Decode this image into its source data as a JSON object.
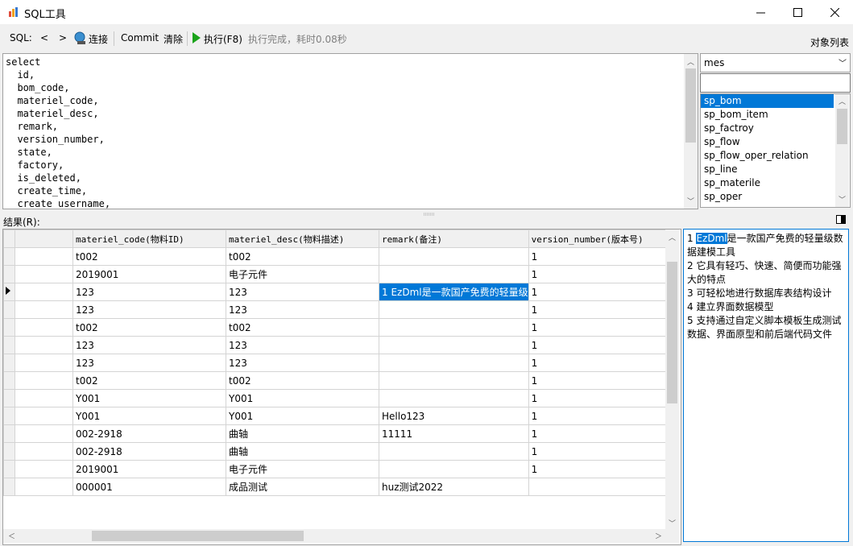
{
  "window": {
    "title": "SQL工具"
  },
  "toolbar": {
    "sql_label": "SQL:",
    "prev": "<",
    "next": ">",
    "connect": "连接",
    "commit": "Commit",
    "clear": "清除",
    "execute": "执行(F8)",
    "status": "执行完成，耗时0.08秒",
    "object_list": "对象列表"
  },
  "editor": {
    "sql_text": "select\n  id,\n  bom_code,\n  materiel_code,\n  materiel_desc,\n  remark,\n  version_number,\n  state,\n  factory,\n  is_deleted,\n  create_time,\n  create_username,"
  },
  "right_panel": {
    "schema": "mes",
    "search_value": "",
    "tables": [
      "sp_bom",
      "sp_bom_item",
      "sp_factroy",
      "sp_flow",
      "sp_flow_oper_relation",
      "sp_line",
      "sp_materile",
      "sp_oper"
    ]
  },
  "results": {
    "label": "结果(R):",
    "columns": [
      "",
      "materiel_code(物料ID)",
      "materiel_desc(物料描述)",
      "remark(备注)",
      "version_number(版本号)"
    ],
    "rows": [
      [
        "",
        "t002",
        "t002",
        "",
        "1"
      ],
      [
        "",
        "2019001",
        "电子元件",
        "",
        "1"
      ],
      [
        "",
        "123",
        "123",
        "1 EzDml是一款国产免费的轻量级",
        "1"
      ],
      [
        "",
        "123",
        "123",
        "",
        "1"
      ],
      [
        "",
        "t002",
        "t002",
        "",
        "1"
      ],
      [
        "",
        "123",
        "123",
        "",
        "1"
      ],
      [
        "",
        "123",
        "123",
        "",
        "1"
      ],
      [
        "",
        "t002",
        "t002",
        "",
        "1"
      ],
      [
        "",
        "Y001",
        "Y001",
        "",
        "1"
      ],
      [
        "",
        "Y001",
        "Y001",
        "Hello123",
        "1"
      ],
      [
        "",
        "002-2918",
        "曲轴",
        "11111",
        "1"
      ],
      [
        "",
        "002-2918",
        "曲轴",
        "",
        "1"
      ],
      [
        "",
        "2019001",
        "电子元件",
        "",
        "1"
      ],
      [
        "",
        "000001",
        "成品测试",
        "huz测试2022",
        ""
      ]
    ]
  },
  "preview": {
    "selected_word": "EzDml",
    "line1_prefix": "1 ",
    "line1_rest": "是一款国产免费的轻量级数据建模工具",
    "lines": [
      "2 它具有轻巧、快速、简便而功能强大的特点",
      "3 可轻松地进行数据库表结构设计",
      "4 建立界面数据模型",
      "5 支持通过自定义脚本模板生成测试数据、界面原型和前后端代码文件"
    ]
  },
  "colors": {
    "selection": "#0078d7",
    "execute_icon": "#1aa31a"
  }
}
